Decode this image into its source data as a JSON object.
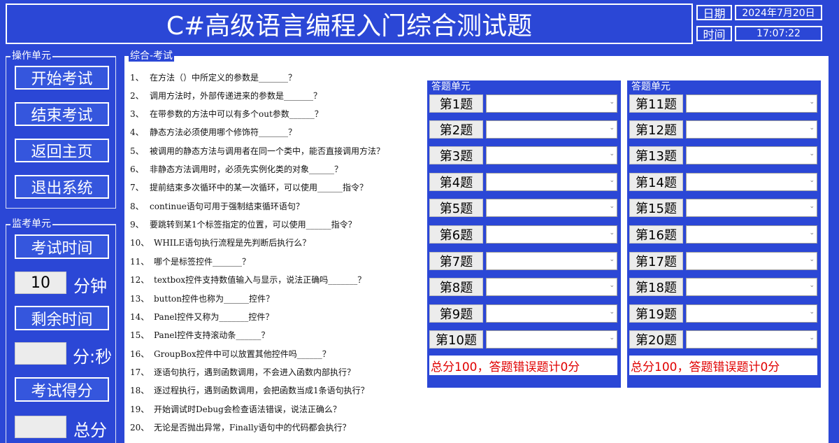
{
  "header": {
    "title": "C#高级语言编程入门综合测试题",
    "date_label": "日期",
    "date_value": "2024年7月20日",
    "time_label": "时间",
    "time_value": "17:07:22"
  },
  "operation_unit": {
    "title": "操作单元",
    "buttons": [
      "开始考试",
      "结束考试",
      "返回主页",
      "退出系统"
    ]
  },
  "proctor_unit": {
    "title": "监考单元",
    "exam_time_label": "考试时间",
    "minutes_value": "10",
    "minutes_unit": "分钟",
    "remaining_label": "剩余时间",
    "remaining_value": "",
    "remaining_unit": "分:秒",
    "score_label": "考试得分",
    "score_value": "",
    "score_unit": "总分"
  },
  "exam": {
    "title": "综合-考试",
    "questions": [
      {
        "num": "1、",
        "text": "在方法（）中所定义的参数是_______？"
      },
      {
        "num": "2、",
        "text": "调用方法时，外部传递进来的参数是_______？"
      },
      {
        "num": "3、",
        "text": "在带参数的方法中可以有多个out参数______？"
      },
      {
        "num": "4、",
        "text": "静态方法必须使用哪个修饰符_______？"
      },
      {
        "num": "5、",
        "text": "被调用的静态方法与调用者在同一个类中，能否直接调用方法？"
      },
      {
        "num": "6、",
        "text": "非静态方法调用时，必须先实例化类的对象______？"
      },
      {
        "num": "7、",
        "text": "提前结束多次循环中的某一次循环，可以使用______指令？"
      },
      {
        "num": "8、",
        "text": "continue语句可用于强制结束循环语句？"
      },
      {
        "num": "9、",
        "text": "要跳转到某1个标签指定的位置，可以使用______指令？"
      },
      {
        "num": "10、",
        "text": "WHILE语句执行流程是先判断后执行么？"
      },
      {
        "num": "11、",
        "text": "哪个是标签控件_______？"
      },
      {
        "num": "12、",
        "text": "textbox控件支持数值输入与显示，说法正确吗_______？"
      },
      {
        "num": "13、",
        "text": "button控件也称为______控件？"
      },
      {
        "num": "14、",
        "text": "Panel控件又称为_______控件？"
      },
      {
        "num": "15、",
        "text": "Panel控件支持滚动条______？"
      },
      {
        "num": "16、",
        "text": "GroupBox控件中可以放置其他控件吗______？"
      },
      {
        "num": "17、",
        "text": "逐语句执行，遇到函数调用，不会进入函数内部执行？"
      },
      {
        "num": "18、",
        "text": "逐过程执行，遇到函数调用，会把函数当成1条语句执行？"
      },
      {
        "num": "19、",
        "text": "开始调试时Debug会检查语法错误，说法正确么？"
      },
      {
        "num": "20、",
        "text": "无论是否抛出异常，Finally语句中的代码都会执行？"
      }
    ]
  },
  "answer_panels": [
    {
      "title": "答题单元",
      "labels": [
        "第1题",
        "第2题",
        "第3题",
        "第4题",
        "第5题",
        "第6题",
        "第7题",
        "第8题",
        "第9题",
        "第10题"
      ],
      "score_text": "总分100，答题错误题计0分"
    },
    {
      "title": "答题单元",
      "labels": [
        "第11题",
        "第12题",
        "第13题",
        "第14题",
        "第15题",
        "第16题",
        "第17题",
        "第18题",
        "第19题",
        "第20题"
      ],
      "score_text": "总分100，答题错误题计0分"
    }
  ],
  "colors": {
    "background": "#2b47d6",
    "panel_bg": "#ffffff",
    "score_text": "#e00000"
  },
  "icons": {
    "dropdown": "chevron-down-icon"
  }
}
